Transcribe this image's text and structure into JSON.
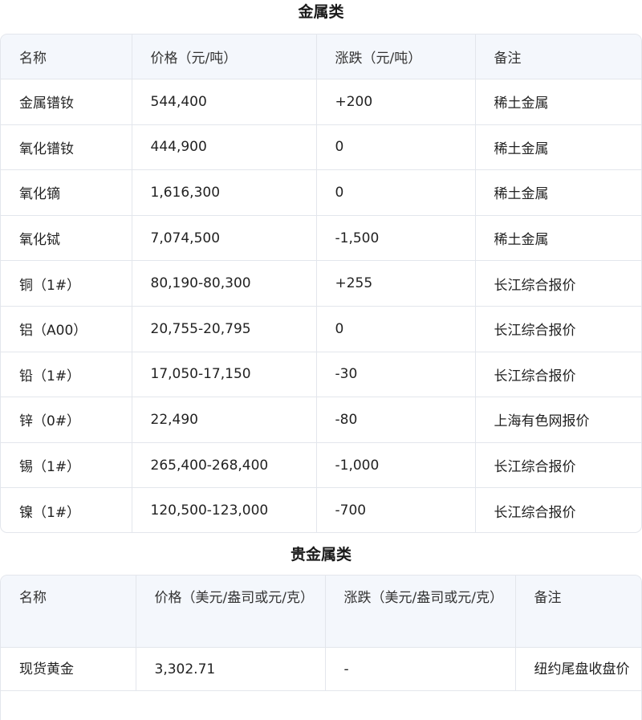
{
  "metals": {
    "title": "金属类",
    "headers": [
      "名称",
      "价格（元/吨）",
      "涨跌（元/吨）",
      "备注"
    ],
    "rows": [
      [
        "金属镨钕",
        "544,400",
        "+200",
        "稀土金属"
      ],
      [
        "氧化镨钕",
        "444,900",
        "0",
        "稀土金属"
      ],
      [
        "氧化镝",
        "1,616,300",
        "0",
        "稀土金属"
      ],
      [
        "氧化铽",
        "7,074,500",
        "-1,500",
        "稀土金属"
      ],
      [
        "铜（1#）",
        "80,190-80,300",
        "+255",
        "长江综合报价"
      ],
      [
        "铝（A00）",
        "20,755-20,795",
        "0",
        "长江综合报价"
      ],
      [
        "铅（1#）",
        "17,050-17,150",
        "-30",
        "长江综合报价"
      ],
      [
        "锌（0#）",
        "22,490",
        "-80",
        "上海有色网报价"
      ],
      [
        "锡（1#）",
        "265,400-268,400",
        "-1,000",
        "长江综合报价"
      ],
      [
        "镍（1#）",
        "120,500-123,000",
        "-700",
        "长江综合报价"
      ]
    ]
  },
  "precious": {
    "title": "贵金属类",
    "headers": [
      "名称",
      "价格（美元/盎司或元/克）",
      "涨跌（美元/盎司或元/克）",
      "备注"
    ],
    "rows": [
      [
        "现货黄金",
        "3,302.71",
        "-",
        "纽约尾盘收盘价"
      ]
    ]
  }
}
